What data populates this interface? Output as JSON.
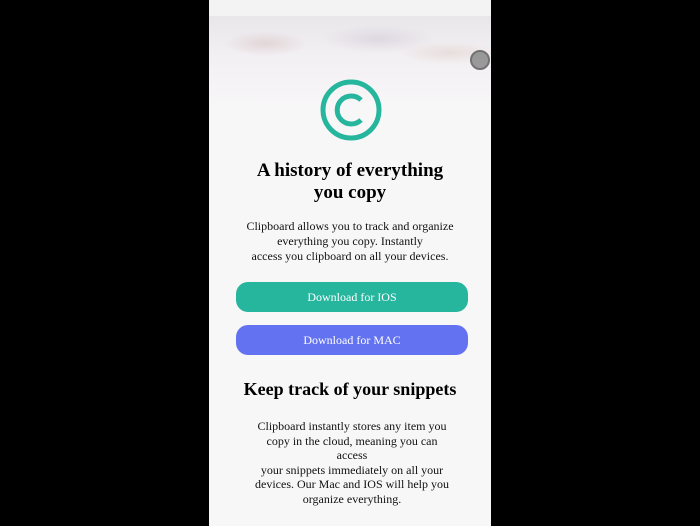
{
  "colors": {
    "accent_teal": "#26b59d",
    "accent_blue": "#6272f0",
    "page_background": "#f8f7f8",
    "outer_background": "#000000"
  },
  "hero": {
    "logo_icon": "copyright-icon",
    "title_line1": "A history of everything",
    "title_line2": "you copy",
    "description_line1": "Clipboard allows you to track and organize",
    "description_line2": "everything you copy. Instantly",
    "description_line3": "access you clipboard on all your devices."
  },
  "buttons": {
    "ios_label": "Download for IOS",
    "mac_label": "Download for MAC"
  },
  "snippets": {
    "title": "Keep track of your snippets",
    "text_lines": [
      "Clipboard instantly stores any item you",
      "copy in the cloud, meaning you can",
      "access",
      "your snippets immediately on all your",
      "devices. Our Mac and IOS will help you",
      "organize everything."
    ]
  }
}
